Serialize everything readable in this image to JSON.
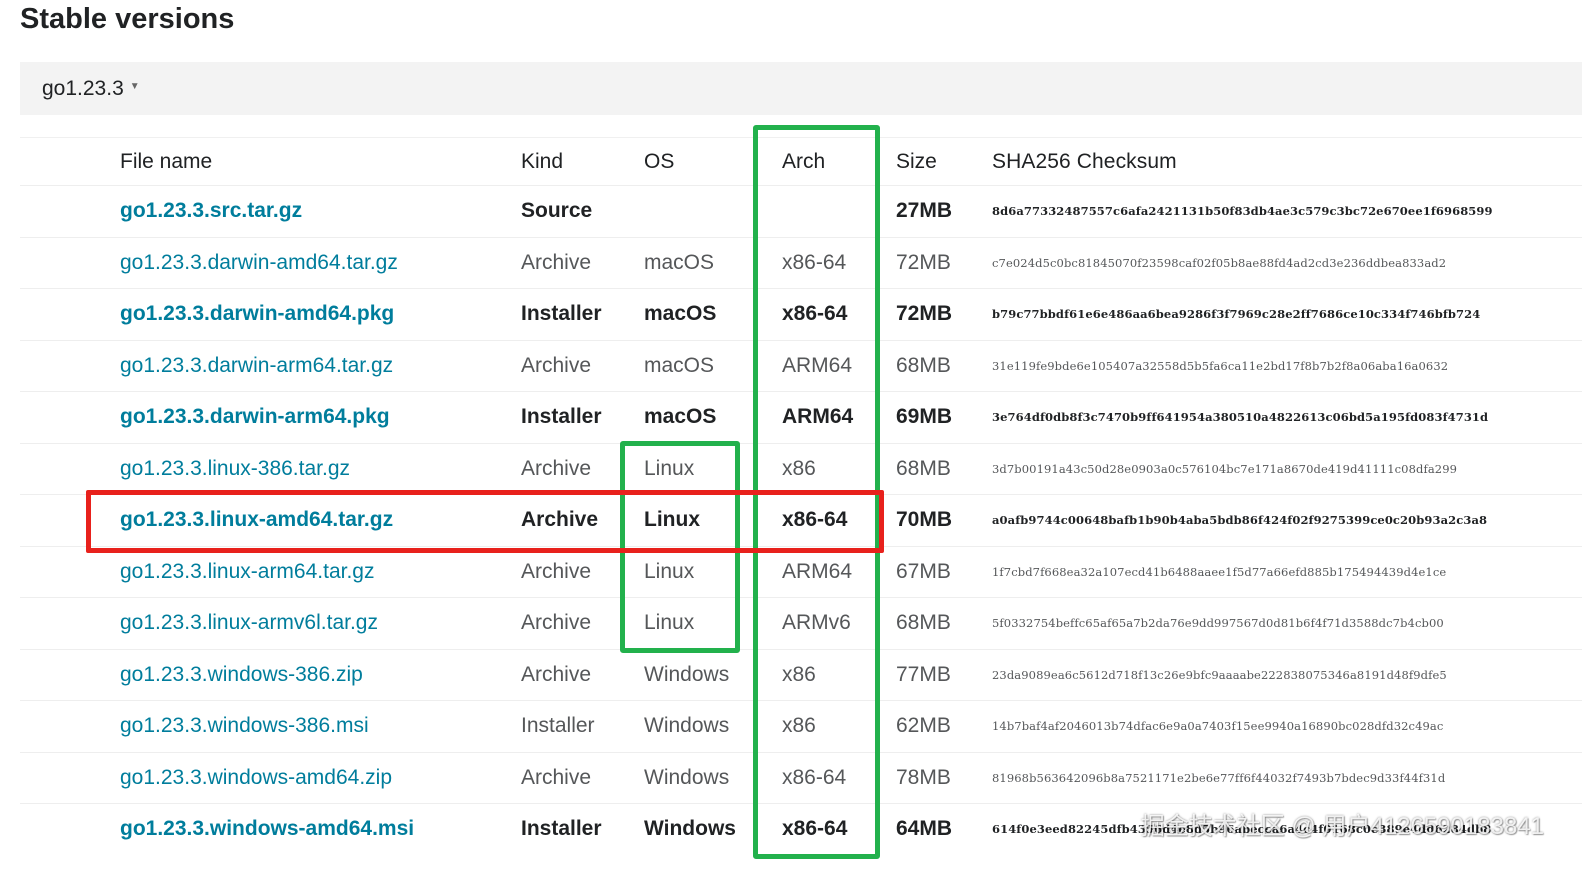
{
  "heading": "Stable versions",
  "version_selector": {
    "label": "go1.23.3",
    "caret_icon": "caret-down-icon"
  },
  "table": {
    "headers": {
      "file_name": "File name",
      "kind": "Kind",
      "os": "OS",
      "arch": "Arch",
      "size": "Size",
      "checksum": "SHA256 Checksum"
    },
    "rows": [
      {
        "file": "go1.23.3.src.tar.gz",
        "kind": "Source",
        "os": "",
        "arch": "",
        "size": "27MB",
        "sha": "8d6a77332487557c6afa2421131b50f83db4ae3c579c3bc72e670ee1f6968599",
        "featured": true
      },
      {
        "file": "go1.23.3.darwin-amd64.tar.gz",
        "kind": "Archive",
        "os": "macOS",
        "arch": "x86-64",
        "size": "72MB",
        "sha": "c7e024d5c0bc81845070f23598caf02f05b8ae88fd4ad2cd3e236ddbea833ad2",
        "featured": false
      },
      {
        "file": "go1.23.3.darwin-amd64.pkg",
        "kind": "Installer",
        "os": "macOS",
        "arch": "x86-64",
        "size": "72MB",
        "sha": "b79c77bbdf61e6e486aa6bea9286f3f7969c28e2ff7686ce10c334f746bfb724",
        "featured": true
      },
      {
        "file": "go1.23.3.darwin-arm64.tar.gz",
        "kind": "Archive",
        "os": "macOS",
        "arch": "ARM64",
        "size": "68MB",
        "sha": "31e119fe9bde6e105407a32558d5b5fa6ca11e2bd17f8b7b2f8a06aba16a0632",
        "featured": false
      },
      {
        "file": "go1.23.3.darwin-arm64.pkg",
        "kind": "Installer",
        "os": "macOS",
        "arch": "ARM64",
        "size": "69MB",
        "sha": "3e764df0db8f3c7470b9ff641954a380510a4822613c06bd5a195fd083f4731d",
        "featured": true
      },
      {
        "file": "go1.23.3.linux-386.tar.gz",
        "kind": "Archive",
        "os": "Linux",
        "arch": "x86",
        "size": "68MB",
        "sha": "3d7b00191a43c50d28e0903a0c576104bc7e171a8670de419d41111c08dfa299",
        "featured": false
      },
      {
        "file": "go1.23.3.linux-amd64.tar.gz",
        "kind": "Archive",
        "os": "Linux",
        "arch": "x86-64",
        "size": "70MB",
        "sha": "a0afb9744c00648bafb1b90b4aba5bdb86f424f02f9275399ce0c20b93a2c3a8",
        "featured": true
      },
      {
        "file": "go1.23.3.linux-arm64.tar.gz",
        "kind": "Archive",
        "os": "Linux",
        "arch": "ARM64",
        "size": "67MB",
        "sha": "1f7cbd7f668ea32a107ecd41b6488aaee1f5d77a66efd885b175494439d4e1ce",
        "featured": false
      },
      {
        "file": "go1.23.3.linux-armv6l.tar.gz",
        "kind": "Archive",
        "os": "Linux",
        "arch": "ARMv6",
        "size": "68MB",
        "sha": "5f0332754beffc65af65a7b2da76e9dd997567d0d81b6f4f71d3588dc7b4cb00",
        "featured": false
      },
      {
        "file": "go1.23.3.windows-386.zip",
        "kind": "Archive",
        "os": "Windows",
        "arch": "x86",
        "size": "77MB",
        "sha": "23da9089ea6c5612d718f13c26e9bfc9aaaabe222838075346a8191d48f9dfe5",
        "featured": false
      },
      {
        "file": "go1.23.3.windows-386.msi",
        "kind": "Installer",
        "os": "Windows",
        "arch": "x86",
        "size": "62MB",
        "sha": "14b7baf4af2046013b74dfac6e9a0a7403f15ee9940a16890bc028dfd32c49ac",
        "featured": false
      },
      {
        "file": "go1.23.3.windows-amd64.zip",
        "kind": "Archive",
        "os": "Windows",
        "arch": "x86-64",
        "size": "78MB",
        "sha": "81968b563642096b8a7521171e2be6e77ff6f44032f7493b7bdec9d33f44f31d",
        "featured": false
      },
      {
        "file": "go1.23.3.windows-amd64.msi",
        "kind": "Installer",
        "os": "Windows",
        "arch": "x86-64",
        "size": "64MB",
        "sha": "614f0e3eed82245dfb4356d4e8d5b96abecca6a4c4f0168c0e389e4dd6284db8",
        "featured": true
      }
    ]
  },
  "annotations": {
    "arch_box_color": "#22b14c",
    "linux_box_color": "#22b14c",
    "selected_row_box_color": "#e8211c"
  },
  "watermark": "掘金技术社区 @ 用户4126590183841",
  "colors": {
    "link": "#007d9c",
    "text": "#202224",
    "muted": "#555759",
    "bar_bg": "#f3f3f3"
  }
}
